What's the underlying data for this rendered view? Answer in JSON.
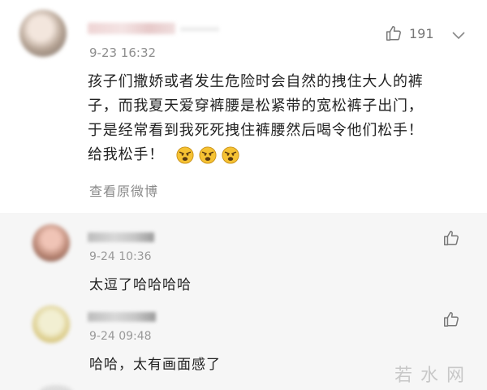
{
  "main_comment": {
    "timestamp": "9-23 16:32",
    "like_count": "191",
    "body_lines": [
      "孩子们撒娇或者发生危险时会自然的拽住大人的裤",
      "子，而我夏天爱穿裤腰是松紧带的宽松裤子出门，",
      "于是经常看到我死死拽住裤腰然后喝令他们松手！",
      "给我松手！"
    ],
    "emojis": [
      "angry-face-icon",
      "angry-face-icon",
      "angry-face-icon"
    ],
    "view_original_label": "查看原微博"
  },
  "replies": [
    {
      "timestamp": "9-24 10:36",
      "text": "太逗了哈哈哈哈"
    },
    {
      "timestamp": "9-24 09:48",
      "text": "哈哈，太有画面感了"
    }
  ],
  "watermark": "若水网"
}
